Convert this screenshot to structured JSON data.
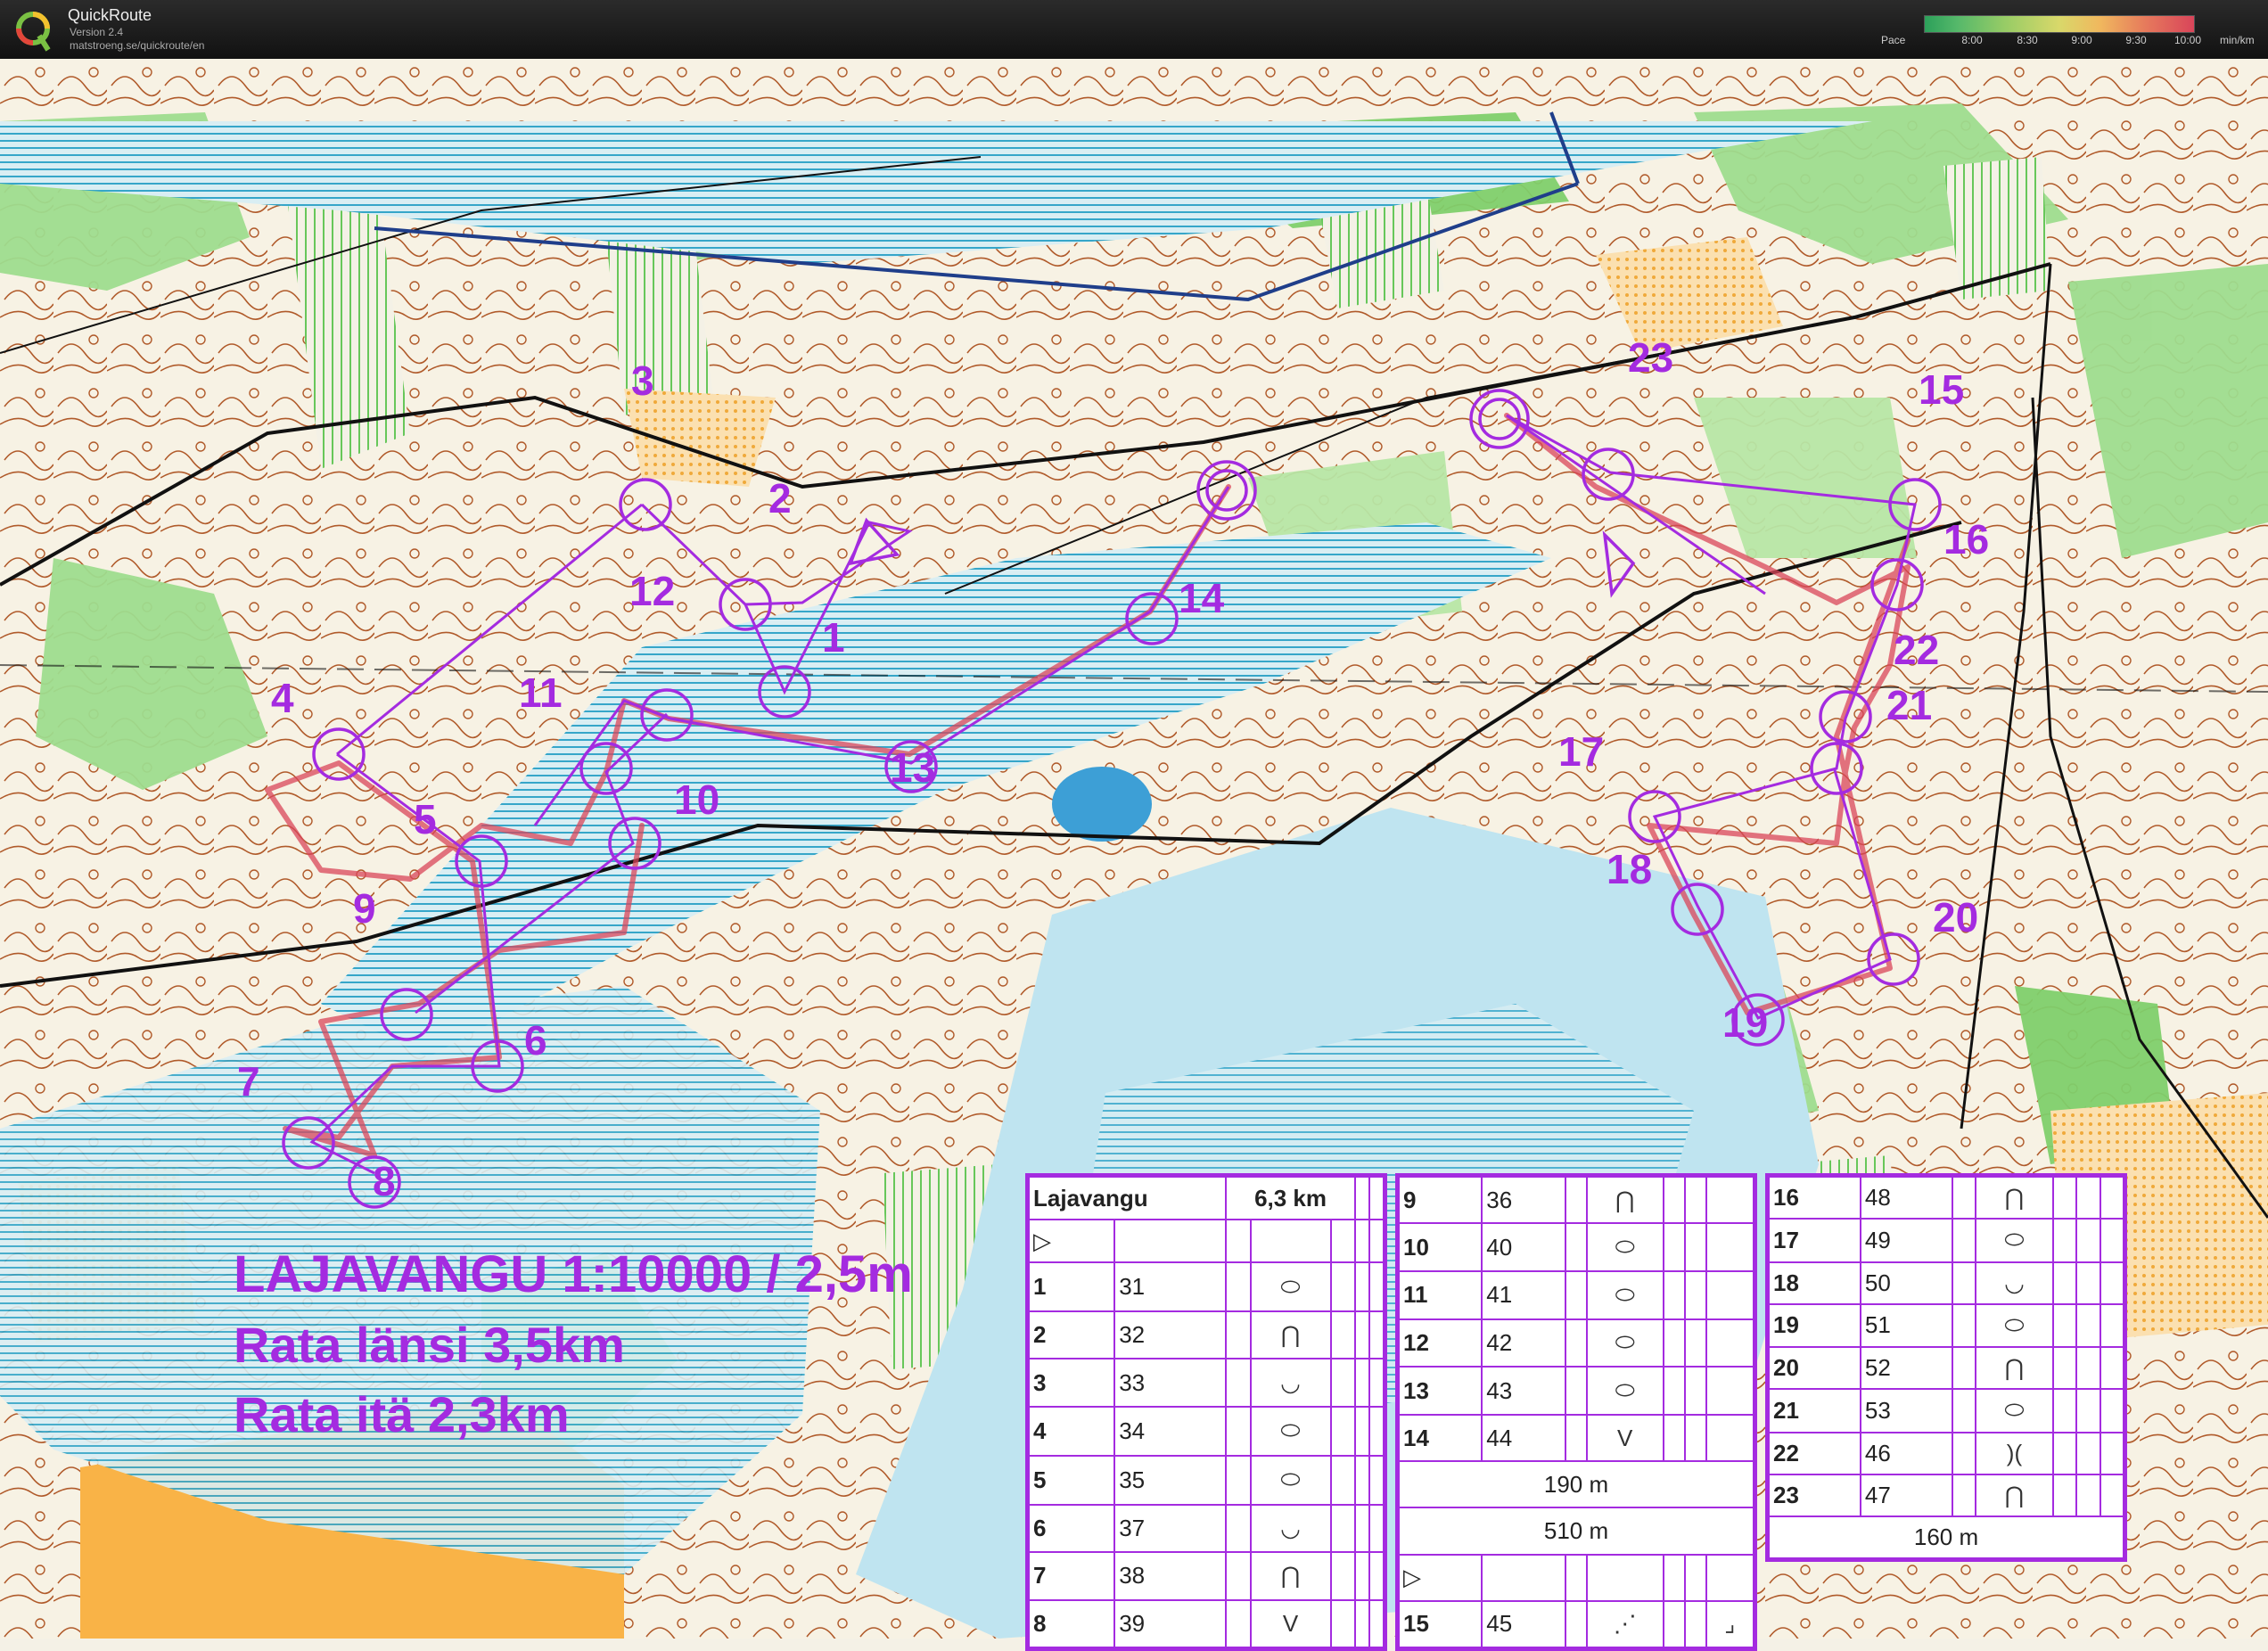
{
  "app": {
    "name": "QuickRoute",
    "version": "Version 2.4",
    "url": "matstroeng.se/quickroute/en",
    "pace_label": "Pace",
    "pace_ticks": [
      "8:00",
      "8:30",
      "9:00",
      "9:30",
      "10:00"
    ],
    "pace_unit": "min/km"
  },
  "map": {
    "title_line1": "LAJAVANGU 1:10000 / 2,5m",
    "title_line2": "Rata länsi 3,5km",
    "title_line3": "Rata itä 2,3km",
    "route_color": "#d9455a",
    "course_color": "#a42be0",
    "controls": [
      "1",
      "2",
      "3",
      "4",
      "5",
      "6",
      "7",
      "8",
      "9",
      "10",
      "11",
      "12",
      "13",
      "14",
      "15",
      "16",
      "17",
      "18",
      "19",
      "20",
      "21",
      "22",
      "23"
    ]
  },
  "descriptions": {
    "card1": {
      "name": "Lajavangu",
      "length": "6,3 km",
      "start_symbol": "▷",
      "rows": [
        {
          "n": "1",
          "code": "31",
          "sym": "⬭"
        },
        {
          "n": "2",
          "code": "32",
          "sym": "⋂"
        },
        {
          "n": "3",
          "code": "33",
          "sym": "◡"
        },
        {
          "n": "4",
          "code": "34",
          "sym": "⬭"
        },
        {
          "n": "5",
          "code": "35",
          "sym": "⬭"
        },
        {
          "n": "6",
          "code": "37",
          "sym": "◡"
        },
        {
          "n": "7",
          "code": "38",
          "sym": "⋂"
        },
        {
          "n": "8",
          "code": "39",
          "sym": "V"
        }
      ]
    },
    "card2": {
      "rows": [
        {
          "n": "9",
          "code": "36",
          "sym": "⋂"
        },
        {
          "n": "10",
          "code": "40",
          "sym": "⬭"
        },
        {
          "n": "11",
          "code": "41",
          "sym": "⬭"
        },
        {
          "n": "12",
          "code": "42",
          "sym": "⬭"
        },
        {
          "n": "13",
          "code": "43",
          "sym": "⬭"
        },
        {
          "n": "14",
          "code": "44",
          "sym": "V"
        }
      ],
      "leg1": "190 m",
      "leg2": "510 m",
      "start_symbol": "▷",
      "row15": {
        "n": "15",
        "code": "45",
        "sym": "⋰"
      },
      "corner_symbol": "⌟"
    },
    "card3": {
      "rows": [
        {
          "n": "16",
          "code": "48",
          "sym": "⋂"
        },
        {
          "n": "17",
          "code": "49",
          "sym": "⬭"
        },
        {
          "n": "18",
          "code": "50",
          "sym": "◡"
        },
        {
          "n": "19",
          "code": "51",
          "sym": "⬭"
        },
        {
          "n": "20",
          "code": "52",
          "sym": "⋂"
        },
        {
          "n": "21",
          "code": "53",
          "sym": "⬭"
        },
        {
          "n": "22",
          "code": "46",
          "sym": ")("
        },
        {
          "n": "23",
          "code": "47",
          "sym": "⋂"
        }
      ],
      "leg": "160 m"
    }
  }
}
